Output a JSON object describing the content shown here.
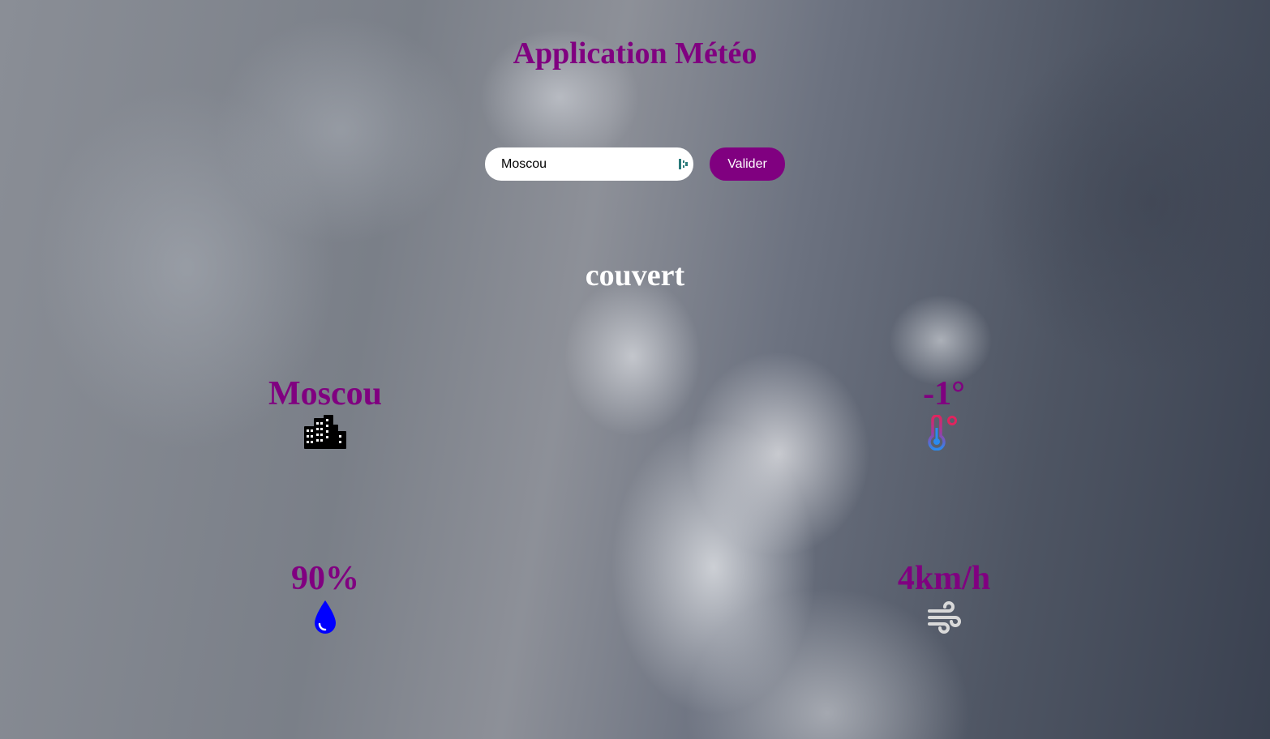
{
  "app": {
    "title": "Application Météo"
  },
  "search": {
    "value": "Moscou",
    "button_label": "Valider"
  },
  "weather": {
    "description": "couvert",
    "city": "Moscou",
    "temperature": "-1°",
    "humidity": "90%",
    "wind": "4km/h"
  },
  "icons": {
    "city": "city-buildings-icon",
    "temperature": "thermometer-celsius-icon",
    "humidity": "water-drop-icon",
    "wind": "wind-icon"
  },
  "colors": {
    "accent": "#800080",
    "humidity_icon": "#0000ff",
    "wind_icon": "#d9d9d9"
  }
}
